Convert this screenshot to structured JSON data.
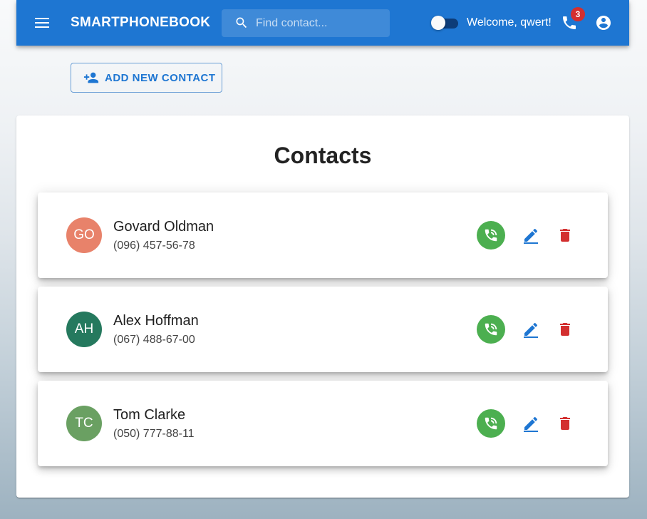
{
  "appbar": {
    "title": "SMARTPHONEBOOK",
    "search_placeholder": "Find contact...",
    "search_value": "",
    "welcome_text": "Welcome, qwert!",
    "calls_badge": "3",
    "brand_color": "#1e76d2"
  },
  "actions": {
    "add_contact_label": "ADD NEW CONTACT"
  },
  "main": {
    "title": "Contacts",
    "contacts": [
      {
        "initials": "GO",
        "name": "Govard Oldman",
        "phone": "(096) 457-56-78",
        "avatar_color": "#e8826a"
      },
      {
        "initials": "AH",
        "name": "Alex Hoffman",
        "phone": "(067) 488-67-00",
        "avatar_color": "#25795e"
      },
      {
        "initials": "TC",
        "name": "Tom Clarke",
        "phone": "(050) 777-88-11",
        "avatar_color": "#6aa062"
      }
    ]
  },
  "icons": {
    "menu": "menu-icon",
    "search": "search-icon",
    "phone": "phone-icon",
    "account": "account-circle-icon",
    "add_person": "person-add-icon",
    "call": "phone-in-talk-icon",
    "edit": "edit-icon",
    "delete": "delete-icon"
  },
  "colors": {
    "call_button": "#4caf50",
    "edit_icon": "#1e76d2",
    "delete_icon": "#d32f2f",
    "badge": "#d32f2f"
  }
}
